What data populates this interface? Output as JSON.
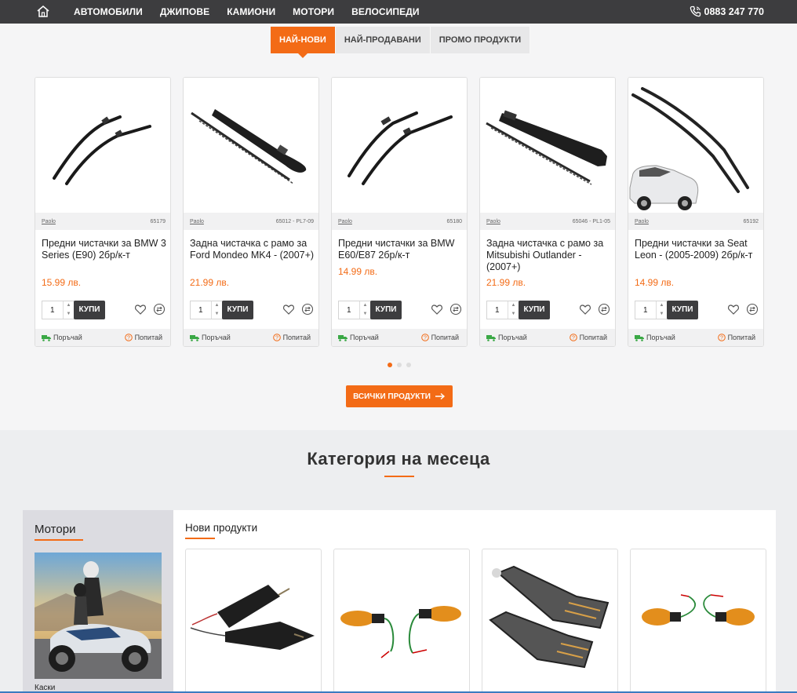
{
  "nav": {
    "items": [
      "АВТОМОБИЛИ",
      "ДЖИПОВЕ",
      "КАМИОНИ",
      "МОТОРИ",
      "ВЕЛОСИПЕДИ"
    ],
    "phone": "0883 247 770"
  },
  "tabs": [
    {
      "label": "НАЙ-НОВИ",
      "active": true
    },
    {
      "label": "НАЙ-ПРОДАВАНИ",
      "active": false
    },
    {
      "label": "ПРОМО ПРОДУКТИ",
      "active": false
    }
  ],
  "products": [
    {
      "brand": "Paolo",
      "code": "65179",
      "title": "Предни чистачки за BMW 3 Series (E90) 2бр/к-т",
      "price": "15.99 лв.",
      "qty": "1",
      "buy": "КУПИ",
      "order": "Поръчай",
      "ask": "Попитай"
    },
    {
      "brand": "Paolo",
      "code": "65012 - PL7-09",
      "title": "Задна чистачка с рамо за Ford Mondeo MK4 - (2007+)",
      "price": "21.99 лв.",
      "qty": "1",
      "buy": "КУПИ",
      "order": "Поръчай",
      "ask": "Попитай"
    },
    {
      "brand": "Paolo",
      "code": "65180",
      "title": "Предни чистачки за BMW E60/E87 2бр/к-т",
      "price": "14.99 лв.",
      "qty": "1",
      "buy": "КУПИ",
      "order": "Поръчай",
      "ask": "Попитай"
    },
    {
      "brand": "Paolo",
      "code": "65046 - PL1-05",
      "title": "Задна чистачка с рамо за Mitsubishi Outlander - (2007+)",
      "price": "21.99 лв.",
      "qty": "1",
      "buy": "КУПИ",
      "order": "Поръчай",
      "ask": "Попитай"
    },
    {
      "brand": "Paolo",
      "code": "65192",
      "title": "Предни чистачки за Seat Leon - (2005-2009) 2бр/к-т",
      "price": "14.99 лв.",
      "qty": "1",
      "buy": "КУПИ",
      "order": "Поръчай",
      "ask": "Попитай"
    }
  ],
  "all_products_button": "ВСИЧКИ ПРОДУКТИ",
  "category": {
    "heading": "Категория на месеца",
    "side_title": "Мотори",
    "side_link": "Каски",
    "main_title": "Нови продукти"
  },
  "colors": {
    "accent": "#f36b16",
    "nav_bg": "#3d3d3f"
  }
}
